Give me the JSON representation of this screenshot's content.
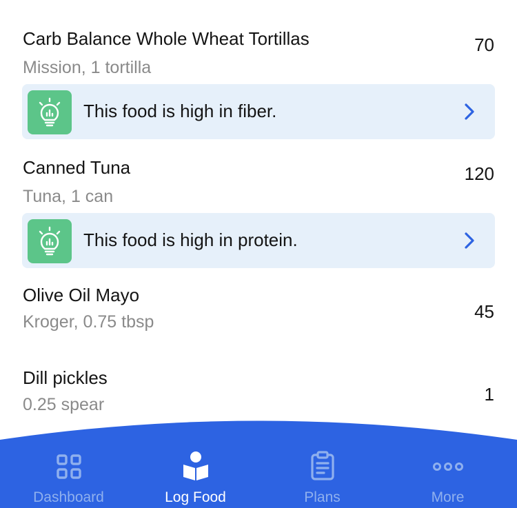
{
  "foods": [
    {
      "name": "Carb Balance Whole Wheat Tortillas",
      "desc": "Mission, 1 tortilla",
      "calories": "70",
      "tip": {
        "text": "This food is high in fiber."
      }
    },
    {
      "name": "Canned Tuna",
      "desc": "Tuna, 1 can",
      "calories": "120",
      "tip": {
        "text": "This food is high in protein."
      }
    },
    {
      "name": "Olive Oil Mayo",
      "desc": "Kroger, 0.75 tbsp",
      "calories": "45"
    },
    {
      "name": "Dill pickles",
      "desc": "0.25 spear",
      "calories": "1"
    }
  ],
  "tabs": [
    {
      "label": "Dashboard",
      "icon": "dashboard-grid-icon",
      "active": false
    },
    {
      "label": "Log Food",
      "icon": "log-food-person-book-icon",
      "active": true
    },
    {
      "label": "Plans",
      "icon": "clipboard-icon",
      "active": false
    },
    {
      "label": "More",
      "icon": "more-dots-icon",
      "active": false
    }
  ],
  "colors": {
    "brand_blue": "#2d63e2",
    "tip_background": "#e6f0fa",
    "tip_icon_green": "#5cc589",
    "chevron_blue": "#2d63e2",
    "inactive_tab": "#8fb0ee",
    "active_tab": "#ffffff"
  }
}
